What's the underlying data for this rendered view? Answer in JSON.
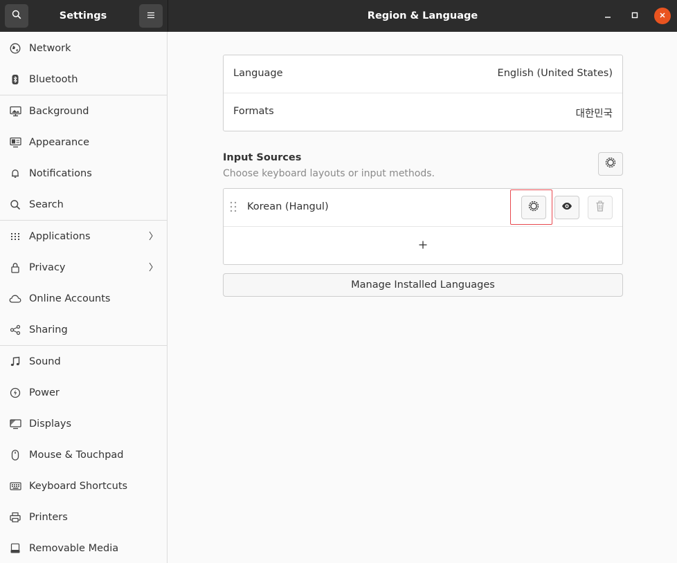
{
  "sidebar_header": {
    "title": "Settings",
    "search_icon": "search-icon",
    "menu_icon": "hamburger-menu-icon"
  },
  "main_header": {
    "title": "Region & Language",
    "minimize_icon": "minimize-icon",
    "maximize_icon": "maximize-icon",
    "close_icon": "close-icon"
  },
  "sidebar": {
    "items": [
      {
        "label": "Network",
        "icon": "network-icon"
      },
      {
        "label": "Bluetooth",
        "icon": "bluetooth-icon"
      },
      {
        "label": "Background",
        "icon": "background-icon"
      },
      {
        "label": "Appearance",
        "icon": "appearance-icon"
      },
      {
        "label": "Notifications",
        "icon": "bell-icon"
      },
      {
        "label": "Search",
        "icon": "search-icon"
      },
      {
        "label": "Applications",
        "icon": "apps-grid-icon",
        "chevron": true
      },
      {
        "label": "Privacy",
        "icon": "lock-icon",
        "chevron": true
      },
      {
        "label": "Online Accounts",
        "icon": "cloud-icon"
      },
      {
        "label": "Sharing",
        "icon": "share-icon"
      },
      {
        "label": "Sound",
        "icon": "music-note-icon"
      },
      {
        "label": "Power",
        "icon": "power-icon"
      },
      {
        "label": "Displays",
        "icon": "display-icon"
      },
      {
        "label": "Mouse & Touchpad",
        "icon": "mouse-icon"
      },
      {
        "label": "Keyboard Shortcuts",
        "icon": "keyboard-icon"
      },
      {
        "label": "Printers",
        "icon": "printer-icon"
      },
      {
        "label": "Removable Media",
        "icon": "removable-media-icon"
      }
    ]
  },
  "language_card": {
    "language_label": "Language",
    "language_value": "English (United States)",
    "formats_label": "Formats",
    "formats_value": "대한민국"
  },
  "input_sources": {
    "title": "Input Sources",
    "subtitle": "Choose keyboard layouts or input methods.",
    "options_icon": "gear-icon",
    "sources": [
      {
        "name": "Korean (Hangul)",
        "settings_icon": "gear-icon",
        "preview_icon": "eye-icon",
        "remove_icon": "trash-icon"
      }
    ],
    "add_icon": "plus-icon"
  },
  "manage_button": "Manage Installed Languages",
  "colors": {
    "header": "#2c2c2c",
    "accent_close": "#e95420",
    "highlight": "#e8474e"
  }
}
